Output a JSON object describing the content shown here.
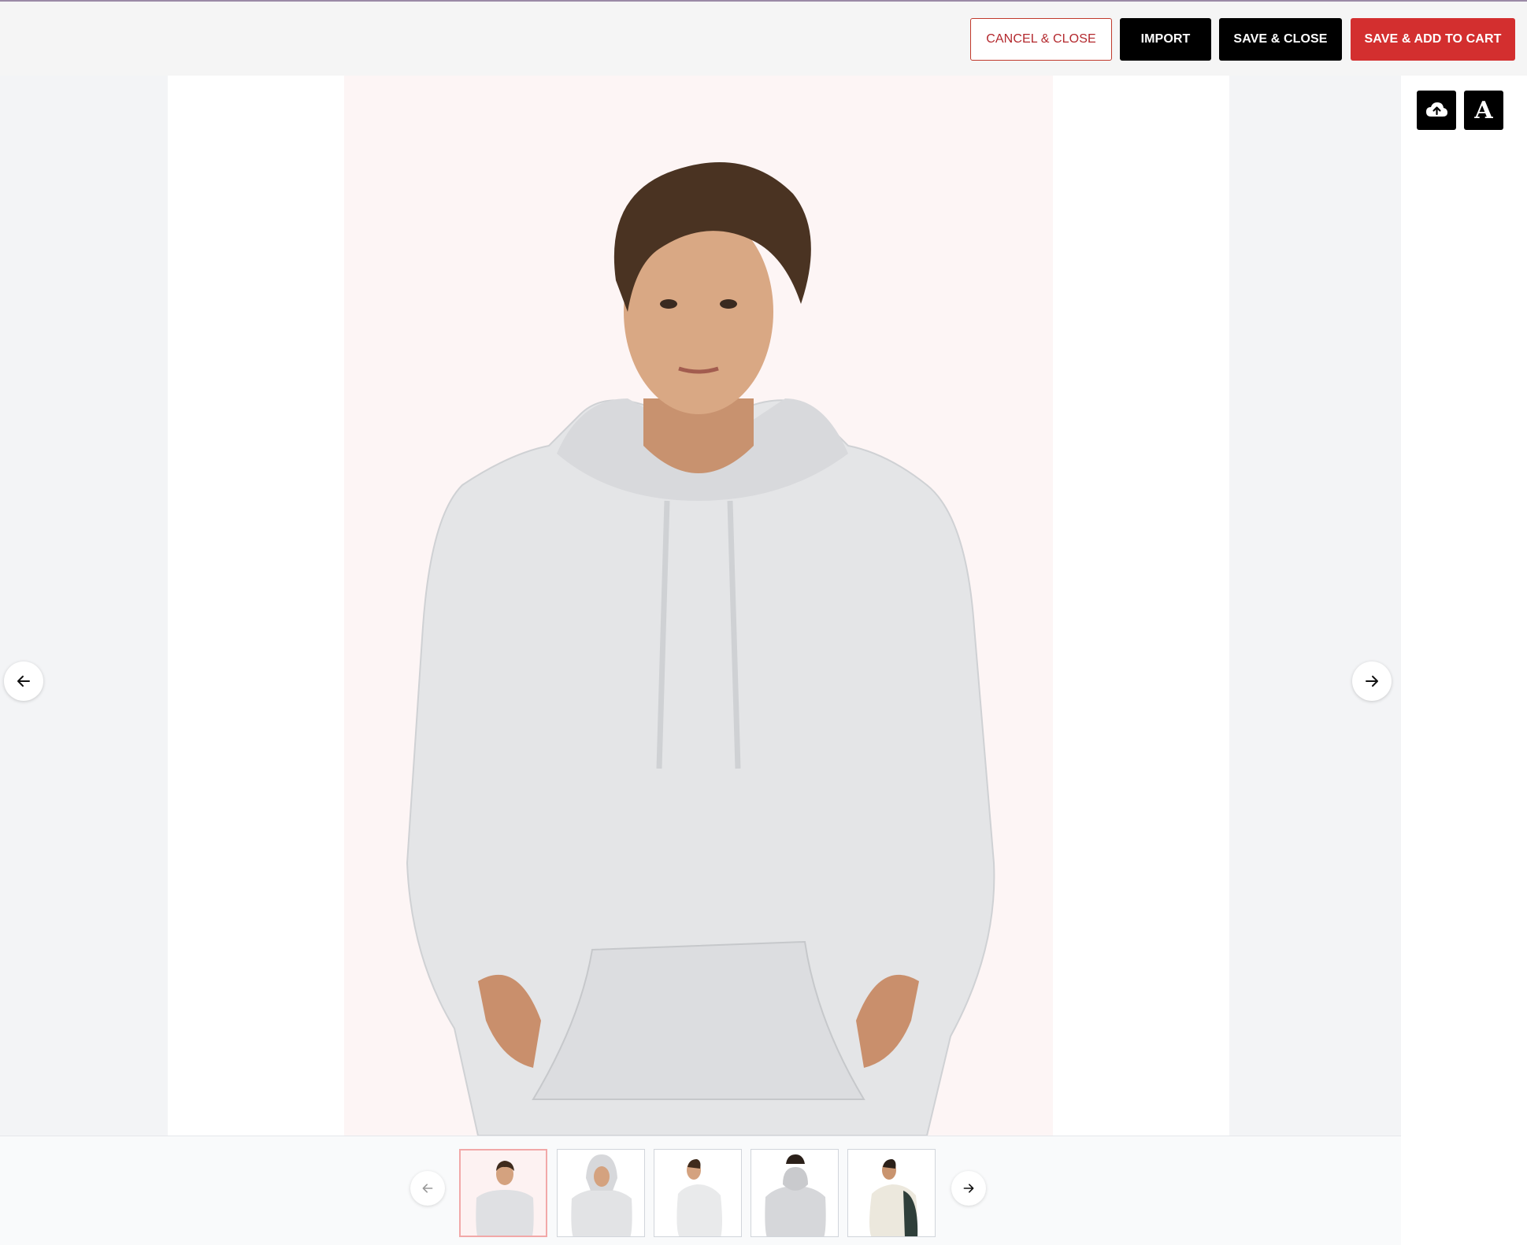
{
  "toolbar": {
    "cancel_label": "CANCEL & CLOSE",
    "import_label": "IMPORT",
    "save_close_label": "SAVE & CLOSE",
    "save_cart_label": "SAVE & ADD TO CART"
  },
  "tools": {
    "upload_icon": "cloud-upload-icon",
    "text_glyph": "A"
  },
  "colors": {
    "accent_red": "#d32f2f",
    "black": "#000000",
    "photo_bg": "#fdf5f5"
  },
  "product": {
    "garment": "white hoodie",
    "views": [
      "front",
      "front-hood-up",
      "side-left",
      "back",
      "side-right"
    ],
    "active_index": 0
  }
}
